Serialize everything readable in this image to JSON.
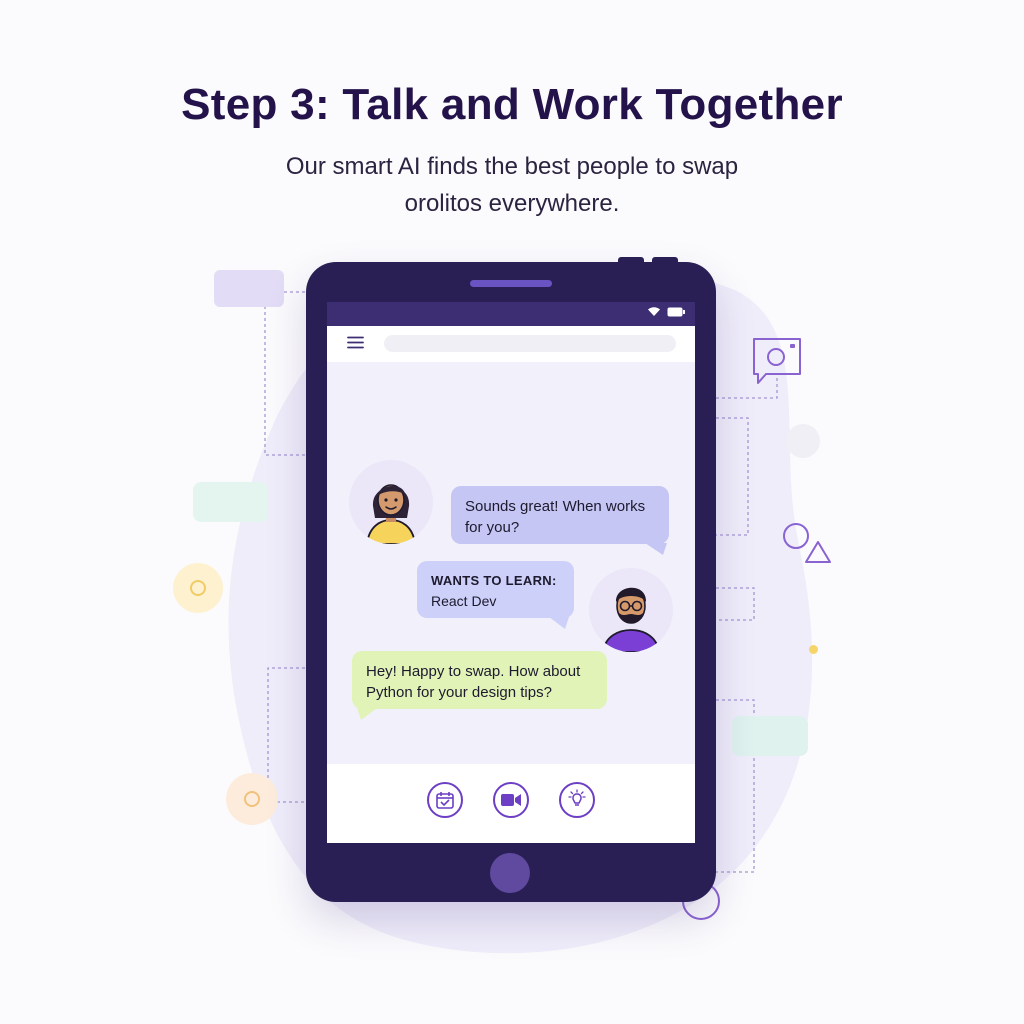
{
  "header": {
    "title": "Step 3: Talk and Work Together",
    "subtitle_line1": "Our smart AI finds the best people to swap",
    "subtitle_line2": "orolitos everywhere."
  },
  "device": {
    "status_icons": [
      "wifi-icon",
      "battery-icon"
    ],
    "appbar": {
      "menu_icon": "menu-icon",
      "search_placeholder": ""
    }
  },
  "chat": {
    "messages": [
      {
        "sender": "woman",
        "text": "Sounds great! When works for you?"
      },
      {
        "sender": "man",
        "label": "WANTS TO LEARN:",
        "value": "React Dev"
      },
      {
        "sender": "woman",
        "text": "Hey! Happy to swap. How about Python for your design tips?"
      }
    ]
  },
  "actions": [
    {
      "name": "calendar-button",
      "icon": "calendar-icon"
    },
    {
      "name": "video-call-button",
      "icon": "video-camera-icon"
    },
    {
      "name": "idea-button",
      "icon": "lightbulb-icon"
    }
  ],
  "colors": {
    "device": "#2a1f55",
    "accent": "#6c3fc4",
    "bubble_blue": "#c5c6f4",
    "bubble_green": "#e1f3b7",
    "title": "#23134a"
  }
}
